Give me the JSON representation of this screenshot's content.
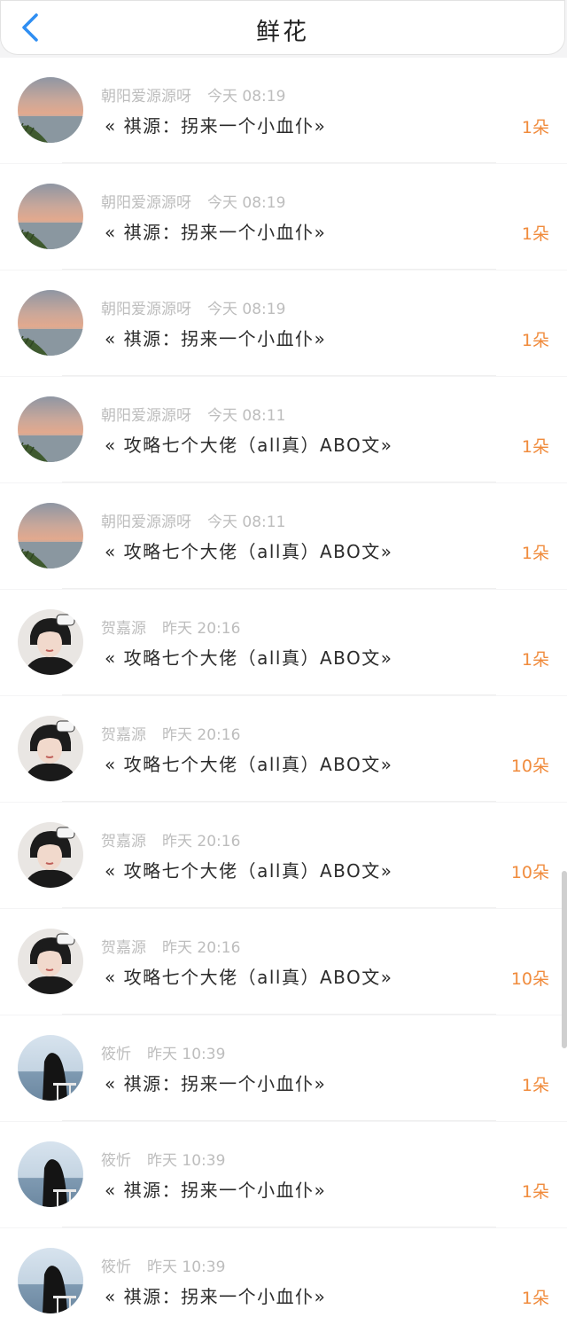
{
  "header": {
    "title": "鲜花",
    "back_icon": "chevron-left-icon",
    "accent": "#2f8ef2"
  },
  "amount_color": "#f08b3c",
  "items": [
    {
      "user": "朝阳爱源源呀",
      "time": "今天 08:19",
      "work": "« 祺源：拐来一个小血仆»",
      "amount": "1朵",
      "avatar": "sunset"
    },
    {
      "user": "朝阳爱源源呀",
      "time": "今天 08:19",
      "work": "« 祺源：拐来一个小血仆»",
      "amount": "1朵",
      "avatar": "sunset"
    },
    {
      "user": "朝阳爱源源呀",
      "time": "今天 08:19",
      "work": "« 祺源：拐来一个小血仆»",
      "amount": "1朵",
      "avatar": "sunset"
    },
    {
      "user": "朝阳爱源源呀",
      "time": "今天 08:11",
      "work": "« 攻略七个大佬（all真）ABO文»",
      "amount": "1朵",
      "avatar": "sunset"
    },
    {
      "user": "朝阳爱源源呀",
      "time": "今天 08:11",
      "work": "« 攻略七个大佬（all真）ABO文»",
      "amount": "1朵",
      "avatar": "sunset"
    },
    {
      "user": "贺嘉源",
      "time": "昨天 20:16",
      "work": "« 攻略七个大佬（all真）ABO文»",
      "amount": "1朵",
      "avatar": "person"
    },
    {
      "user": "贺嘉源",
      "time": "昨天 20:16",
      "work": "« 攻略七个大佬（all真）ABO文»",
      "amount": "10朵",
      "avatar": "person"
    },
    {
      "user": "贺嘉源",
      "time": "昨天 20:16",
      "work": "« 攻略七个大佬（all真）ABO文»",
      "amount": "10朵",
      "avatar": "person"
    },
    {
      "user": "贺嘉源",
      "time": "昨天 20:16",
      "work": "« 攻略七个大佬（all真）ABO文»",
      "amount": "10朵",
      "avatar": "person"
    },
    {
      "user": "筱忻",
      "time": "昨天 10:39",
      "work": "« 祺源：拐来一个小血仆»",
      "amount": "1朵",
      "avatar": "seaside"
    },
    {
      "user": "筱忻",
      "time": "昨天 10:39",
      "work": "« 祺源：拐来一个小血仆»",
      "amount": "1朵",
      "avatar": "seaside"
    },
    {
      "user": "筱忻",
      "time": "昨天 10:39",
      "work": "« 祺源：拐来一个小血仆»",
      "amount": "1朵",
      "avatar": "seaside"
    }
  ]
}
